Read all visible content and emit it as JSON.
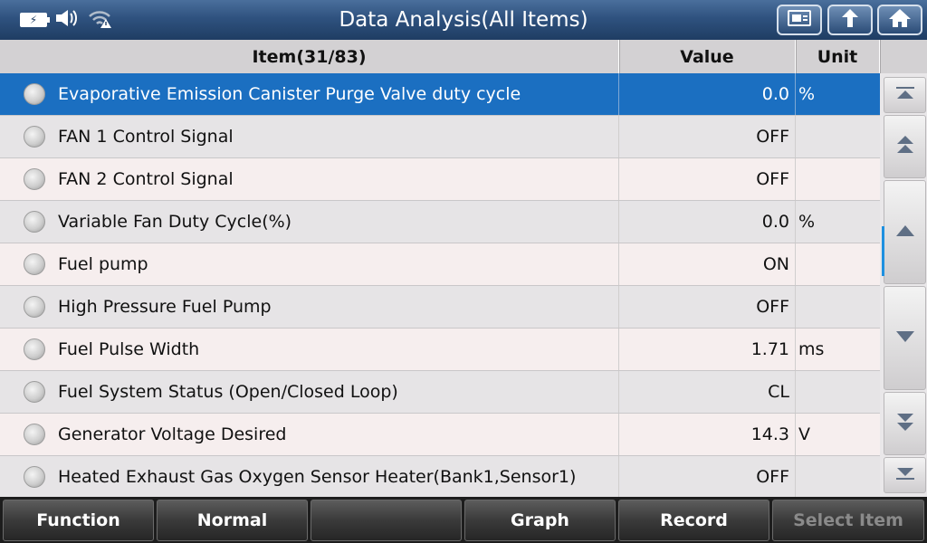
{
  "window": {
    "title": "Data Analysis(All Items)"
  },
  "status_icons": [
    "battery-charging-icon",
    "speaker-icon",
    "wifi-warning-icon"
  ],
  "toolbar_icons": [
    "report-icon",
    "back-up-icon",
    "home-icon"
  ],
  "table": {
    "headers": {
      "item": "Item(31/83)",
      "value": "Value",
      "unit": "Unit"
    },
    "rows": [
      {
        "name": "Evaporative Emission Canister Purge Valve duty cycle",
        "value": "0.0",
        "unit": "%",
        "selected": true
      },
      {
        "name": "FAN 1 Control Signal",
        "value": "OFF",
        "unit": ""
      },
      {
        "name": "FAN 2 Control Signal",
        "value": "OFF",
        "unit": ""
      },
      {
        "name": "Variable Fan Duty Cycle(%)",
        "value": "0.0",
        "unit": "%"
      },
      {
        "name": "Fuel pump",
        "value": "ON",
        "unit": ""
      },
      {
        "name": "High Pressure Fuel Pump",
        "value": "OFF",
        "unit": ""
      },
      {
        "name": "Fuel Pulse Width",
        "value": "1.71",
        "unit": "ms"
      },
      {
        "name": "Fuel System Status (Open/Closed Loop)",
        "value": "CL",
        "unit": ""
      },
      {
        "name": "Generator Voltage Desired",
        "value": "14.3",
        "unit": "V"
      },
      {
        "name": "Heated Exhaust Gas Oxygen Sensor Heater(Bank1,Sensor1)",
        "value": "OFF",
        "unit": ""
      }
    ]
  },
  "scroll_buttons": [
    "scroll-top-icon",
    "page-up-icon",
    "line-up-icon",
    "line-down-icon",
    "page-down-icon",
    "scroll-bottom-icon"
  ],
  "function_bar": {
    "function": "Function",
    "normal": "Normal",
    "blank": "",
    "graph": "Graph",
    "record": "Record",
    "select_item": "Select Item"
  },
  "colors": {
    "title_bar": "#2f527f",
    "selected_row": "#1b6fc1",
    "accent": "#1e90e0"
  }
}
